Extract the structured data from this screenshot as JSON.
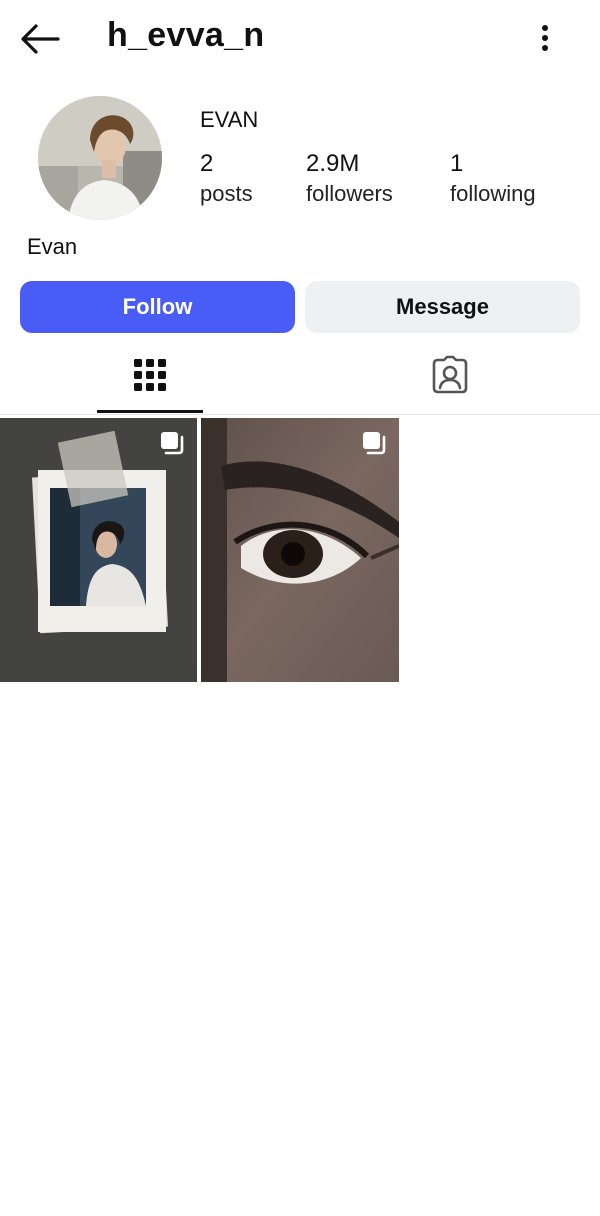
{
  "header": {
    "username": "h_evva_n",
    "back_icon": "arrow-left-icon",
    "more_icon": "more-vertical-icon"
  },
  "profile": {
    "display_name": "EVAN",
    "bio_name": "Evan",
    "stats": [
      {
        "value": "2",
        "label": "posts"
      },
      {
        "value": "2.9M",
        "label": "followers"
      },
      {
        "value": "1",
        "label": "following"
      }
    ]
  },
  "actions": {
    "follow_label": "Follow",
    "message_label": "Message"
  },
  "tabs": [
    {
      "name": "grid",
      "icon": "grid-icon",
      "selected": true
    },
    {
      "name": "tagged",
      "icon": "tagged-person-icon",
      "selected": false
    }
  ],
  "colors": {
    "accent": "#4a5cf6",
    "secondary_button": "#eef0f4"
  },
  "posts": [
    {
      "type": "carousel",
      "icon": "multiple-images-icon"
    },
    {
      "type": "carousel",
      "icon": "multiple-images-icon"
    }
  ]
}
